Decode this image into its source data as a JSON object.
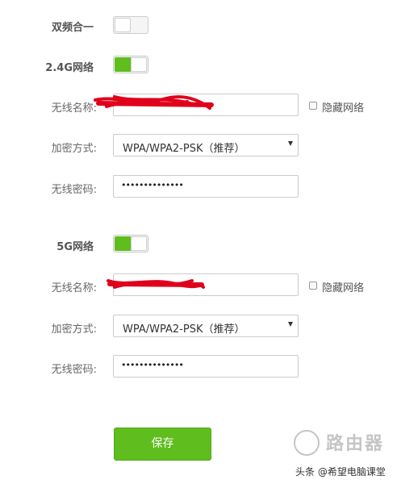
{
  "dual_band": {
    "label": "双频合一",
    "enabled": false
  },
  "band_24g": {
    "title": "2.4G网络",
    "enabled": true,
    "ssid_label": "无线名称:",
    "ssid_value": "",
    "hide_label": "隐藏网络",
    "hide_checked": false,
    "encryption_label": "加密方式:",
    "encryption_value": "WPA/WPA2-PSK（推荐）",
    "password_label": "无线密码:",
    "password_mask": "••••••••••••••"
  },
  "band_5g": {
    "title": "5G网络",
    "enabled": true,
    "ssid_label": "无线名称:",
    "ssid_value": "",
    "hide_label": "隐藏网络",
    "hide_checked": false,
    "encryption_label": "加密方式:",
    "encryption_value": "WPA/WPA2-PSK（推荐）",
    "password_label": "无线密码:",
    "password_mask": "••••••••••••••"
  },
  "save_button_label": "保存",
  "watermark": {
    "logo_text": "路由器",
    "attribution": "头条 @希望电脑课堂"
  },
  "colors": {
    "accent_green": "#5fbd1e",
    "redaction_red": "#e0001b"
  }
}
